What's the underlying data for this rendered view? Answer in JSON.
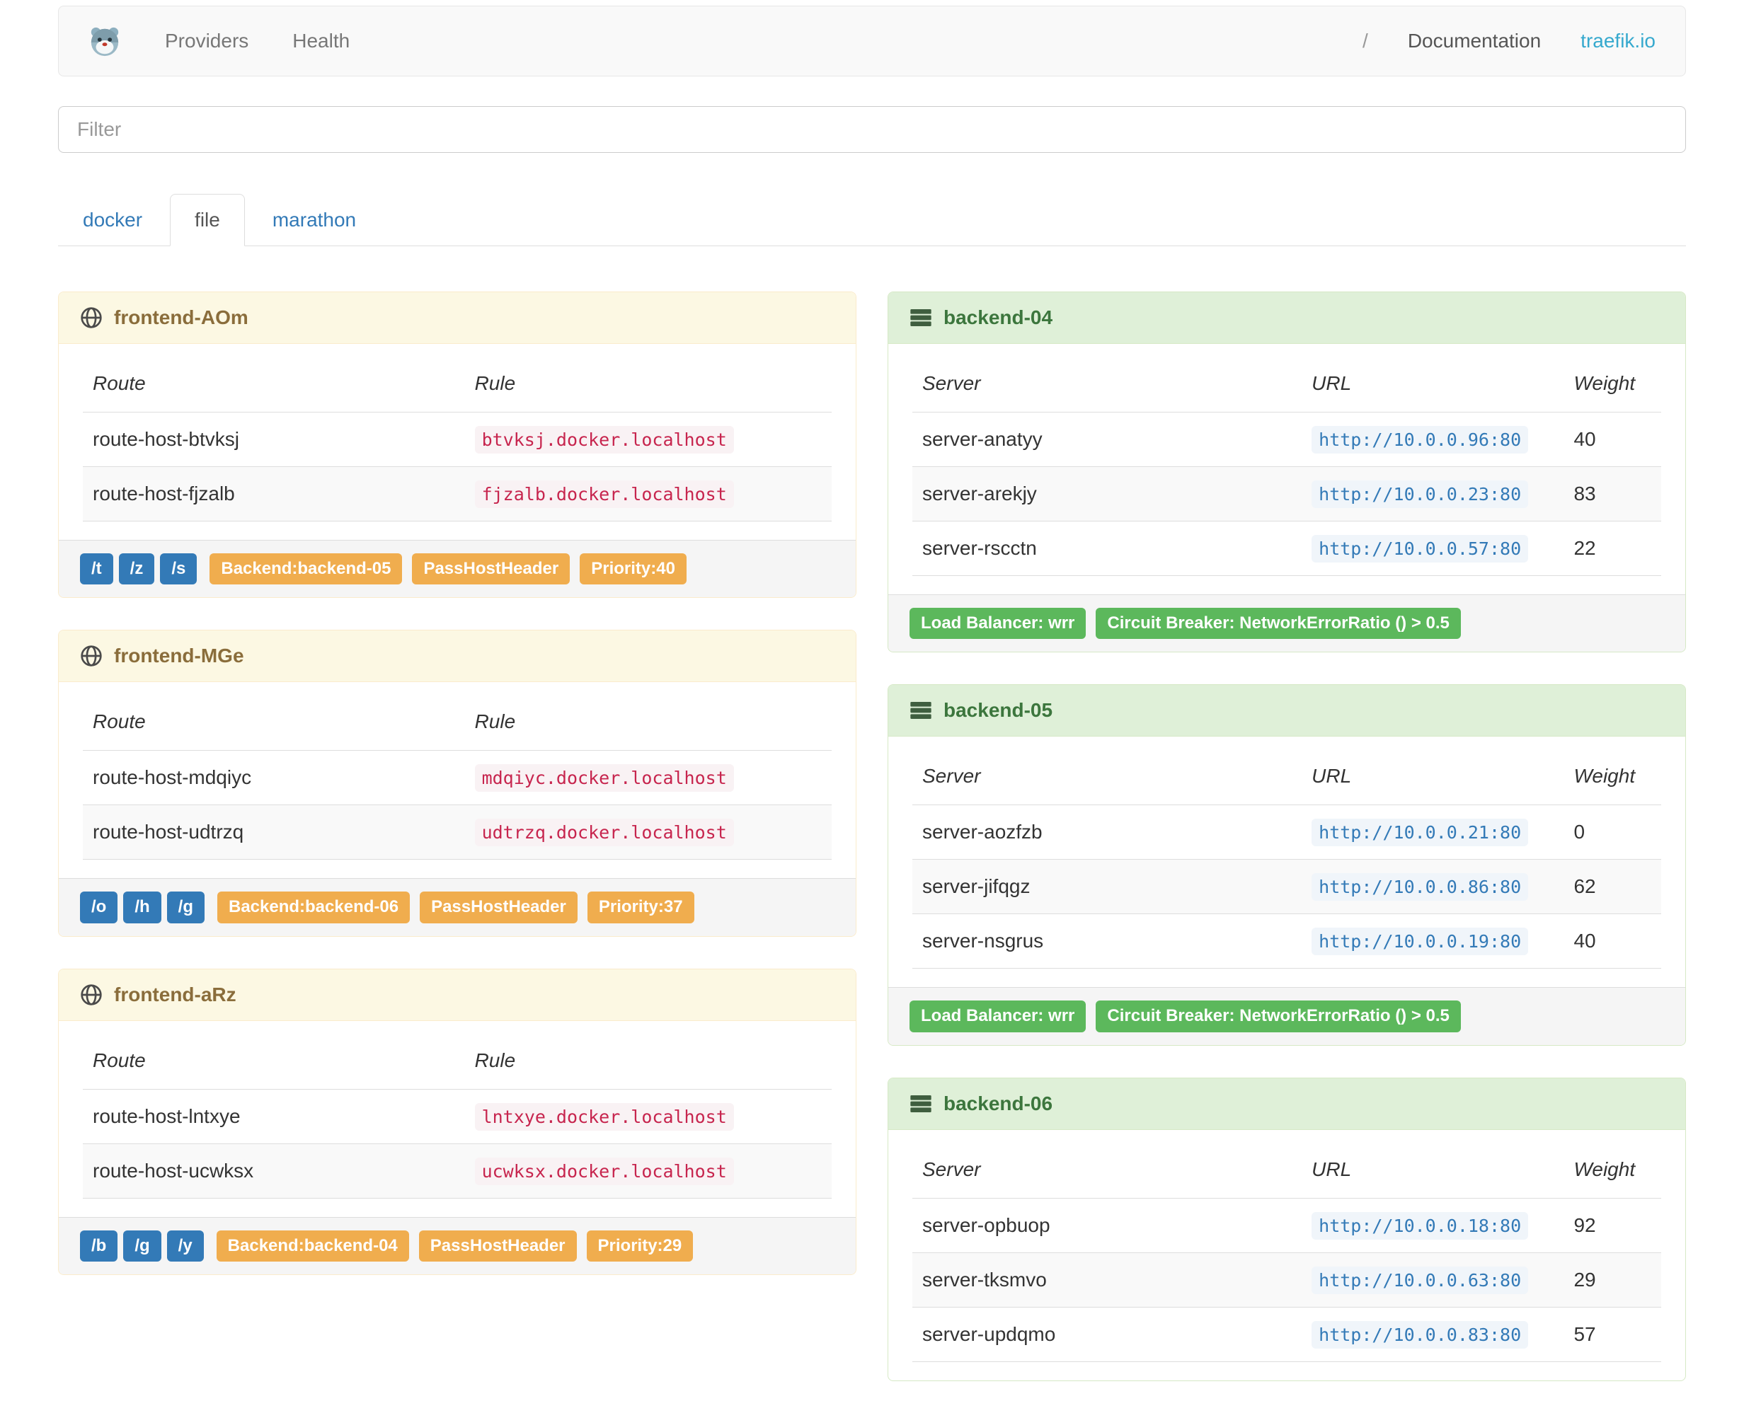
{
  "navbar": {
    "links": [
      "Providers",
      "Health"
    ],
    "separator": "/",
    "doc_link": "Documentation",
    "site_link": "traefik.io"
  },
  "filter": {
    "placeholder": "Filter"
  },
  "tabs": [
    {
      "label": "docker",
      "active": false
    },
    {
      "label": "file",
      "active": true
    },
    {
      "label": "marathon",
      "active": false
    }
  ],
  "icons": {
    "logo": "traefik-logo",
    "frontend": "globe-icon",
    "backend": "server-icon"
  },
  "colors": {
    "frontend_header_bg": "#fcf8e3",
    "frontend_header_text": "#8a6d3b",
    "frontend_border": "#faebcc",
    "backend_header_bg": "#dff0d8",
    "backend_header_text": "#3c763d",
    "backend_border": "#d6e9c6",
    "badge_blue": "#337ab7",
    "badge_orange": "#f0ad4e",
    "badge_green": "#5cb85c",
    "rule_code_text": "#c7254e",
    "url_code_text": "#337ab7",
    "link_blue": "#337ab7",
    "brand_cyan": "#36a9ce"
  },
  "frontends": [
    {
      "title": "frontend-AOm",
      "columns": [
        "Route",
        "Rule"
      ],
      "rows": [
        {
          "route": "route-host-btvksj",
          "rule": "btvksj.docker.localhost"
        },
        {
          "route": "route-host-fjzalb",
          "rule": "fjzalb.docker.localhost"
        }
      ],
      "paths": [
        "/t",
        "/z",
        "/s"
      ],
      "badges": [
        "Backend:backend-05",
        "PassHostHeader",
        "Priority:40"
      ]
    },
    {
      "title": "frontend-MGe",
      "columns": [
        "Route",
        "Rule"
      ],
      "rows": [
        {
          "route": "route-host-mdqiyc",
          "rule": "mdqiyc.docker.localhost"
        },
        {
          "route": "route-host-udtrzq",
          "rule": "udtrzq.docker.localhost"
        }
      ],
      "paths": [
        "/o",
        "/h",
        "/g"
      ],
      "badges": [
        "Backend:backend-06",
        "PassHostHeader",
        "Priority:37"
      ]
    },
    {
      "title": "frontend-aRz",
      "columns": [
        "Route",
        "Rule"
      ],
      "rows": [
        {
          "route": "route-host-lntxye",
          "rule": "lntxye.docker.localhost"
        },
        {
          "route": "route-host-ucwksx",
          "rule": "ucwksx.docker.localhost"
        }
      ],
      "paths": [
        "/b",
        "/g",
        "/y"
      ],
      "badges": [
        "Backend:backend-04",
        "PassHostHeader",
        "Priority:29"
      ]
    }
  ],
  "backends": [
    {
      "title": "backend-04",
      "columns": [
        "Server",
        "URL",
        "Weight"
      ],
      "rows": [
        {
          "server": "server-anatyy",
          "url": "http://10.0.0.96:80",
          "weight": "40"
        },
        {
          "server": "server-arekjy",
          "url": "http://10.0.0.23:80",
          "weight": "83"
        },
        {
          "server": "server-rscctn",
          "url": "http://10.0.0.57:80",
          "weight": "22"
        }
      ],
      "badges": [
        "Load Balancer: wrr",
        "Circuit Breaker: NetworkErrorRatio () > 0.5"
      ]
    },
    {
      "title": "backend-05",
      "columns": [
        "Server",
        "URL",
        "Weight"
      ],
      "rows": [
        {
          "server": "server-aozfzb",
          "url": "http://10.0.0.21:80",
          "weight": "0"
        },
        {
          "server": "server-jifqgz",
          "url": "http://10.0.0.86:80",
          "weight": "62"
        },
        {
          "server": "server-nsgrus",
          "url": "http://10.0.0.19:80",
          "weight": "40"
        }
      ],
      "badges": [
        "Load Balancer: wrr",
        "Circuit Breaker: NetworkErrorRatio () > 0.5"
      ]
    },
    {
      "title": "backend-06",
      "columns": [
        "Server",
        "URL",
        "Weight"
      ],
      "rows": [
        {
          "server": "server-opbuop",
          "url": "http://10.0.0.18:80",
          "weight": "92"
        },
        {
          "server": "server-tksmvo",
          "url": "http://10.0.0.63:80",
          "weight": "29"
        },
        {
          "server": "server-updqmo",
          "url": "http://10.0.0.83:80",
          "weight": "57"
        }
      ]
    }
  ]
}
